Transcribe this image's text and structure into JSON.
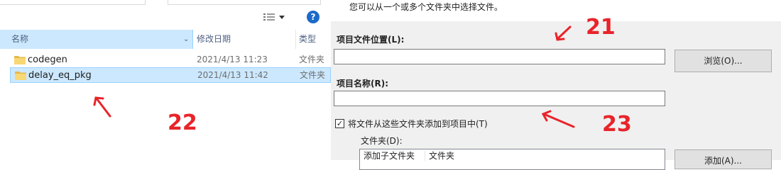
{
  "explorer": {
    "columns": {
      "name": "名称",
      "date": "修改日期",
      "type": "类型"
    },
    "rows": [
      {
        "name": "codegen",
        "date": "2021/4/13 11:23",
        "type": "文件夹",
        "selected": false
      },
      {
        "name": "delay_eq_pkg",
        "date": "2021/4/13 11:42",
        "type": "文件夹",
        "selected": true
      }
    ],
    "help_glyph": "?"
  },
  "dialog": {
    "hint": "您可以从一个或多个文件夹中选择文件。",
    "location_label": "项目文件位置(L):",
    "location_value": "",
    "browse_button": "浏览(O)...",
    "name_label": "项目名称(R):",
    "name_value": "",
    "add_checkbox_label": "将文件从这些文件夹添加到项目中(T)",
    "add_checkbox_checked": true,
    "folders_label": "文件夹(D):",
    "list_headers": [
      "添加子文件夹",
      "文件夹"
    ],
    "add_button": "添加(A)..."
  },
  "annotations": {
    "n21": "21",
    "n22": "22",
    "n23": "23",
    "color": "#e8242a"
  },
  "colors": {
    "selection_bg": "#cce8ff",
    "selection_border": "#99d1ff",
    "dialog_bg": "#f0f0f0",
    "help_icon": "#1b6ac9"
  }
}
